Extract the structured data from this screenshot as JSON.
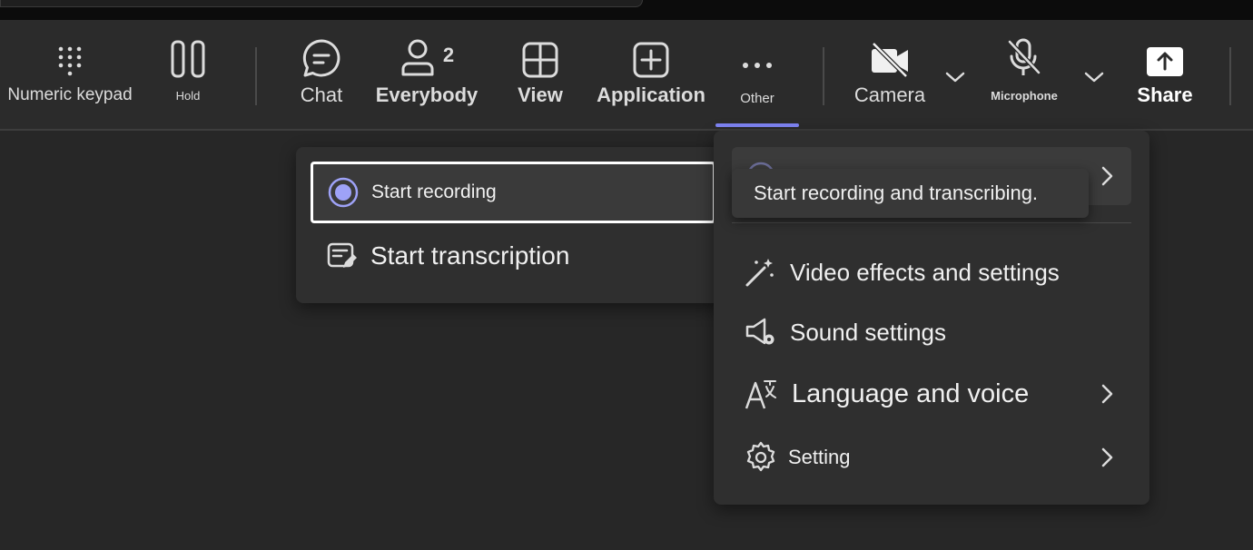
{
  "toolbar": {
    "keypad_label": "Numeric keypad",
    "hold_label": "Hold",
    "chat_label": "Chat",
    "everybody_label": "Everybody",
    "everybody_count": "2",
    "view_label": "View",
    "application_label": "Application",
    "other_label": "Other",
    "camera_label": "Camera",
    "microphone_label": "Microphone",
    "share_label": "Share"
  },
  "record_submenu": {
    "items": [
      {
        "label": "Start recording",
        "icon": "record-icon"
      },
      {
        "label": "Start transcription",
        "icon": "transcription-icon"
      }
    ]
  },
  "other_menu": {
    "items": [
      {
        "label": "Video effects and settings",
        "icon": "magic-wand-icon"
      },
      {
        "label": "Sound settings",
        "icon": "speaker-gear-icon"
      },
      {
        "label": "Language and voice",
        "icon": "language-icon"
      },
      {
        "label": "Setting",
        "icon": "gear-icon"
      }
    ]
  },
  "tooltip": {
    "text": "Start recording and transcribing."
  },
  "colors": {
    "accent": "#7f85f5",
    "background": "#292929",
    "menu_bg": "#2f2f2f"
  }
}
